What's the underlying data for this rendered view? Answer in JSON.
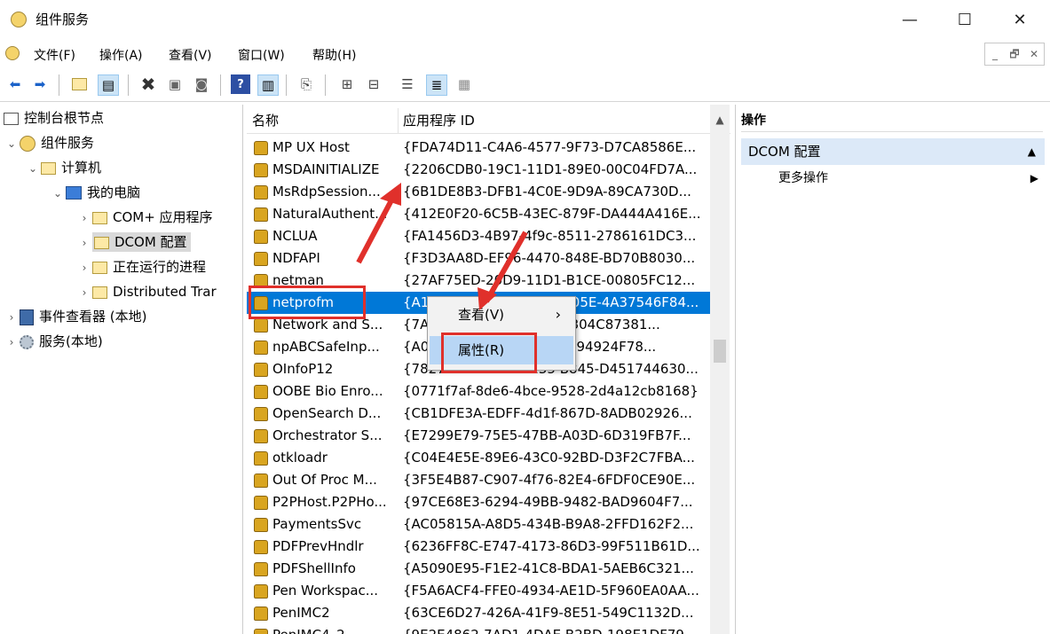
{
  "window": {
    "title": "组件服务",
    "min_glyph": "—",
    "max_glyph": "☐",
    "close_glyph": "✕"
  },
  "menu": {
    "items": [
      "文件(F)",
      "操作(A)",
      "查看(V)",
      "窗口(W)",
      "帮助(H)"
    ],
    "mdi_min": "_",
    "mdi_restore": "🗗",
    "mdi_close": "✕"
  },
  "toolbar": {
    "icons": [
      "back-icon",
      "forward-icon",
      "up-folder-icon",
      "show-hide-tree-icon",
      "delete-icon",
      "properties-icon",
      "refresh-icon",
      "help-icon",
      "show-hide-action-icon",
      "new-window-icon",
      "large-icons-icon",
      "small-icons-icon",
      "list-view-icon",
      "details-view-icon",
      "status-view-icon"
    ]
  },
  "tree": {
    "root": "控制台根节点",
    "component_services": "组件服务",
    "computers": "计算机",
    "my_computer": "我的电脑",
    "com_apps": "COM+ 应用程序",
    "dcom_config": "DCOM 配置",
    "running_processes": "正在运行的进程",
    "distributed": "Distributed Trar",
    "event_viewer": "事件查看器 (本地)",
    "services": "服务(本地)"
  },
  "list": {
    "col_name": "名称",
    "col_appid": "应用程序 ID",
    "rows": [
      {
        "name": "MP UX Host",
        "id": "{FDA74D11-C4A6-4577-9F73-D7CA8586E..."
      },
      {
        "name": "MSDAINITIALIZE",
        "id": "{2206CDB0-19C1-11D1-89E0-00C04FD7A..."
      },
      {
        "name": "MsRdpSession...",
        "id": "{6B1DE8B3-DFB1-4C0E-9D9A-89CA730D..."
      },
      {
        "name": "NaturalAuthent...",
        "id": "{412E0F20-6C5B-43EC-879F-DA444A416E..."
      },
      {
        "name": "NCLUA",
        "id": "{FA1456D3-4B97-4f9c-8511-2786161DC3..."
      },
      {
        "name": "NDFAPI",
        "id": "{F3D3AA8D-EF96-4470-848E-BD70B8030..."
      },
      {
        "name": "netman",
        "id": "{27AF75ED-20D9-11D1-B1CE-00805FC12..."
      },
      {
        "name": "netprofm",
        "id": "{A1F4E726-8CF1-11D1-905E-4A37546F84..."
      },
      {
        "name": "Network and S...",
        "id": "{7A2C6B90-1F39-44F1-0304C87381..."
      },
      {
        "name": "npABCSafeInp...",
        "id": "{A0D8E1F2-3C4B-97D2-D94924F78..."
      },
      {
        "name": "OInfoP12",
        "id": "{7827F2AF-E836-4135-B845-D451744630..."
      },
      {
        "name": "OOBE Bio Enro...",
        "id": "{0771f7af-8de6-4bce-9528-2d4a12cb8168}"
      },
      {
        "name": "OpenSearch D...",
        "id": "{CB1DFE3A-EDFF-4d1f-867D-8ADB02926..."
      },
      {
        "name": "Orchestrator S...",
        "id": "{E7299E79-75E5-47BB-A03D-6D319FB7F..."
      },
      {
        "name": "otkloadr",
        "id": "{C04E4E5E-89E6-43C0-92BD-D3F2C7FBA..."
      },
      {
        "name": "Out Of Proc M...",
        "id": "{3F5E4B87-C907-4f76-82E4-6FDF0CE90E..."
      },
      {
        "name": "P2PHost.P2PHo...",
        "id": "{97CE68E3-6294-49BB-9482-BAD9604F7..."
      },
      {
        "name": "PaymentsSvc",
        "id": "{AC05815A-A8D5-434B-B9A8-2FFD162F2..."
      },
      {
        "name": "PDFPrevHndlr",
        "id": "{6236FF8C-E747-4173-86D3-99F511B61D..."
      },
      {
        "name": "PDFShellInfo",
        "id": "{A5090E95-F1E2-41C8-BDA1-5AEB6C321..."
      },
      {
        "name": "Pen Workspac...",
        "id": "{F5A6ACF4-FFE0-4934-AE1D-5F960EA0AA..."
      },
      {
        "name": "PenIMC2",
        "id": "{63CE6D27-426A-41F9-8E51-549C1132D..."
      },
      {
        "name": "PenIMC4_2",
        "id": "{9E2E4862-7AD1-4DAE-B2BD-198E1DF79..."
      }
    ]
  },
  "actions": {
    "header": "操作",
    "section": "DCOM 配置",
    "section_arrow": "▲",
    "more": "更多操作",
    "more_arrow": "▶"
  },
  "context_menu": {
    "view": "查看(V)",
    "view_arrow": "›",
    "properties": "属性(R)"
  },
  "colors": {
    "selection": "#0078d7",
    "annotation_red": "#e0302b",
    "action_section_bg": "#dce9f8"
  }
}
